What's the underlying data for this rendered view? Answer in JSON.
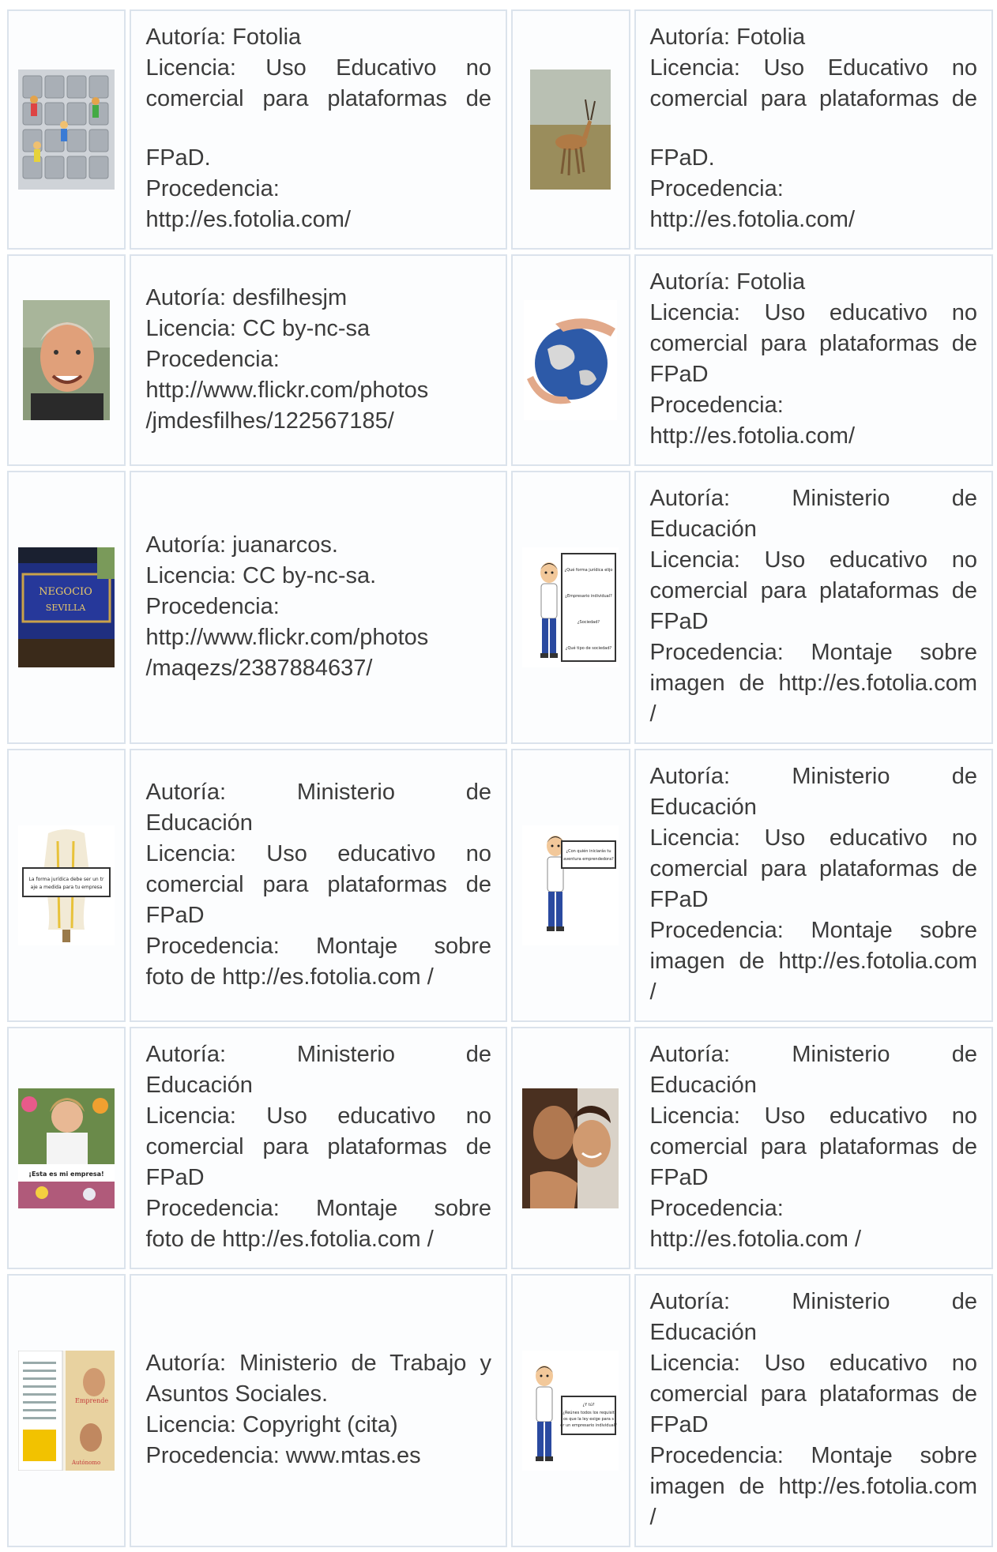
{
  "credits": [
    {
      "lines": [
        "Autoría: Fotolia",
        "Licencia: Uso Educativo no",
        "comercial para plataformas de",
        "",
        "FPaD.",
        "Procedencia:",
        "http://es.fotolia.com/"
      ],
      "image": "keyboard-figures-image"
    },
    {
      "lines": [
        "Autoría: Fotolia",
        "Licencia: Uso Educativo no",
        "comercial para plataformas de",
        "",
        "FPaD.",
        "Procedencia:",
        "http://es.fotolia.com/"
      ],
      "image": "gazelle-image"
    },
    {
      "lines": [
        "Autoría: desfilhesjm",
        "Licencia: CC by-nc-sa",
        "Procedencia:",
        "http://www.flickr.com/photos",
        "/jmdesfilhes/122567185/"
      ],
      "image": "smiling-man-image"
    },
    {
      "lines": [
        "Autoría: Fotolia",
        "Licencia: Uso educativo no",
        "comercial para plataformas de",
        "FPaD",
        "Procedencia:",
        "http://es.fotolia.com/"
      ],
      "image": "globe-in-hands-image"
    },
    {
      "lines": [
        "Autoría: juanarcos.",
        "Licencia: CC by-nc-sa.",
        "Procedencia:",
        "http://www.flickr.com/photos",
        "/maqezs/2387884637/"
      ],
      "image": "storefront-sign-image"
    },
    {
      "lines": [
        "Autoría: Ministerio de",
        "Educación",
        "Licencia: Uso educativo no",
        "comercial para plataformas de",
        "FPaD",
        "Procedencia: Montaje sobre",
        "imagen de http://es.fotolia.com",
        "/"
      ],
      "image": "cartoon-board-image"
    },
    {
      "lines": [
        "Autoría: Ministerio de",
        "Educación",
        "Licencia: Uso educativo no",
        "comercial para plataformas de",
        "FPaD",
        "Procedencia: Montaje sobre",
        "foto de http://es.fotolia.com /"
      ],
      "image": "mannequin-sign-image"
    },
    {
      "lines": [
        "Autoría: Ministerio de",
        "Educación",
        "Licencia: Uso educativo no",
        "comercial para plataformas de",
        "FPaD",
        "Procedencia: Montaje sobre",
        "imagen de http://es.fotolia.com",
        "/"
      ],
      "image": "cartoon-sign-image"
    },
    {
      "lines": [
        "Autoría: Ministerio de",
        "Educación",
        "Licencia: Uso educativo no",
        "comercial para plataformas de",
        "FPaD",
        "Procedencia: Montaje sobre",
        "foto de http://es.fotolia.com /"
      ],
      "image": "florist-image"
    },
    {
      "lines": [
        "Autoría: Ministerio de",
        "Educación",
        "Licencia: Uso educativo no",
        "comercial para plataformas de",
        "FPaD",
        "Procedencia:",
        "http://es.fotolia.com /"
      ],
      "image": "couple-image"
    },
    {
      "lines": [
        "Autoría: Ministerio de Trabajo y",
        "Asuntos Sociales.",
        "Licencia: Copyright (cita)",
        "Procedencia: www.mtas.es"
      ],
      "image": "brochure-image"
    },
    {
      "lines": [
        "Autoría: Ministerio de",
        "Educación",
        "Licencia: Uso educativo no",
        "comercial para plataformas de",
        "FPaD",
        "Procedencia: Montaje sobre",
        "imagen de http://es.fotolia.com",
        "/"
      ],
      "image": "cartoon-sign-image-2"
    }
  ],
  "sign_texts": {
    "board": [
      "¿Qué forma jurídica elijo para mi empresa?",
      "¿Empresario individual?",
      "¿Sociedad?",
      "¿Qué tipo de sociedad?"
    ],
    "mannequin": [
      "La forma jurídica debe ser un traje a medida para tu empresa"
    ],
    "question": [
      "¿Con quién iniciarás tu aventura emprendedora?"
    ],
    "florist": [
      "¡Esta es mi empresa!"
    ],
    "requirements": [
      "¿Y tú?",
      "¿Reúnes todos los requisitos que la ley exige para ser un empresario individual?"
    ],
    "brochure": [
      "Emprende",
      "Autónomo"
    ]
  },
  "colors": {
    "border": "#dbe3ec",
    "cell_bg": "#fcfdfe",
    "text": "#3c3c3c"
  }
}
